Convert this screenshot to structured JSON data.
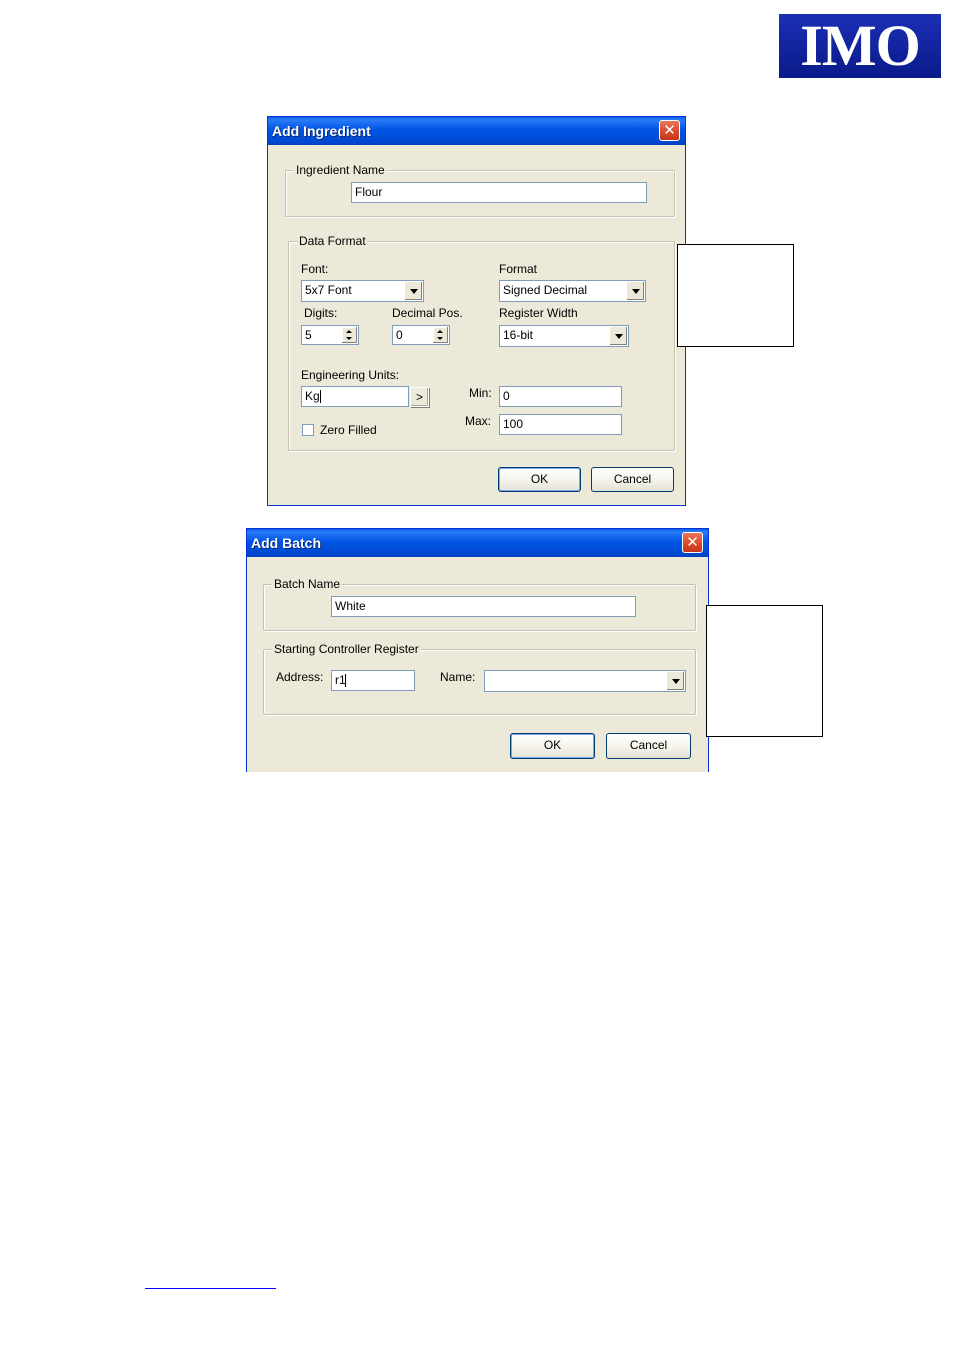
{
  "logo": {
    "text": "IMO"
  },
  "ingredient_dialog": {
    "title": "Add Ingredient",
    "close_glyph": "✕",
    "ingredient_name_group": "Ingredient Name",
    "ingredient_name_value": "Flour",
    "data_format_group": "Data Format",
    "font_label": "Font:",
    "font_value": "5x7 Font",
    "format_label": "Format",
    "format_value": "Signed Decimal",
    "digits_label": "Digits:",
    "digits_value": "5",
    "decimal_pos_label": "Decimal Pos.",
    "decimal_pos_value": "0",
    "register_width_label": "Register Width",
    "register_width_value": "16-bit",
    "engineering_units_label": "Engineering Units:",
    "engineering_units_value": "Kg",
    "units_picker_glyph": ">",
    "min_label": "Min:",
    "min_value": "0",
    "max_label": "Max:",
    "max_value": "100",
    "zero_filled_label": "Zero Filled",
    "ok_label": "OK",
    "cancel_label": "Cancel"
  },
  "batch_dialog": {
    "title": "Add Batch",
    "close_glyph": "✕",
    "batch_name_group": "Batch Name",
    "batch_name_value": "White",
    "start_register_group": "Starting Controller Register",
    "address_label": "Address:",
    "address_value": "r1",
    "name_label": "Name:",
    "name_value": "",
    "ok_label": "OK",
    "cancel_label": "Cancel"
  },
  "colors": {
    "titlebar": "#0055e5",
    "dialog_bg": "#ece9d8",
    "close_button": "#d9472a",
    "logo_bg": "#1b2fb5"
  }
}
